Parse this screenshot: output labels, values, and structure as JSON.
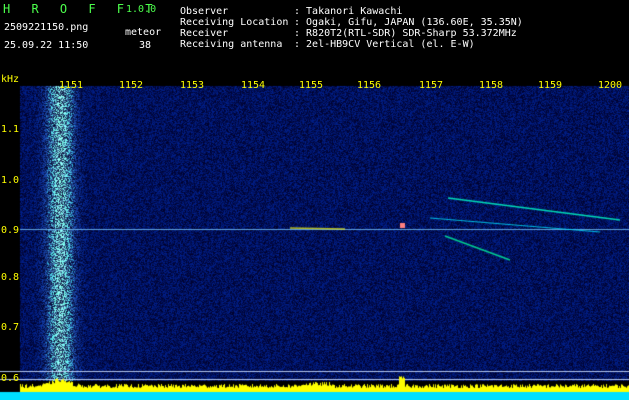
{
  "header": {
    "app_name": "H R O F F T",
    "version": "1.0.0",
    "filename": "2509221150.png",
    "datetime": "25.09.22 11:50",
    "detector_label": "meteor",
    "detector_count": "38",
    "info": [
      {
        "label": "Observer",
        "value": ": Takanori Kawachi"
      },
      {
        "label": "Receiving Location",
        "value": ": Ogaki, Gifu, JAPAN (136.60E, 35.35N)"
      },
      {
        "label": "Receiver",
        "value": ": R820T2(RTL-SDR) SDR-Sharp 53.372MHz"
      },
      {
        "label": "Receiving antenna",
        "value": ": 2el-HB9CV Vertical (el. E-W)"
      }
    ]
  },
  "axes": {
    "y_unit": "kHz",
    "x_ticks": [
      "1151",
      "1152",
      "1153",
      "1154",
      "1155",
      "1156",
      "1157",
      "1158",
      "1159",
      "1200"
    ],
    "y_ticks": [
      "1.1",
      "1.0",
      "0.9",
      "0.8",
      "0.7",
      "0.6"
    ]
  },
  "colors": {
    "background": "#000000",
    "header_green": "#4cff4c",
    "axis_yellow": "#ffff00",
    "noise_blue": "#1030c0",
    "signal_cyan": "#00ffff",
    "signal_yellow": "#ffff00"
  }
}
